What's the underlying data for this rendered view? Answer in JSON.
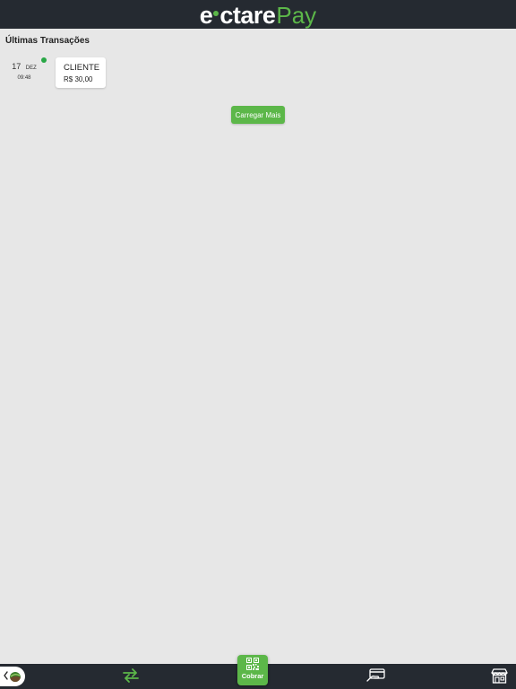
{
  "header": {
    "logo_e": "e",
    "logo_ctare": "ctare",
    "logo_pay": "Pay"
  },
  "transactions": {
    "title": "Últimas Transações",
    "items": [
      {
        "day": "17",
        "month": "DEZ",
        "time": "09:48",
        "name": "CLIENTE",
        "amount": "R$ 30,00",
        "status_color": "#28a745"
      }
    ],
    "load_more_label": "Carregar Mais"
  },
  "bottom_nav": {
    "back_icon": "chevron-left-icon",
    "avatar_icon": "leaf-avatar-icon",
    "transfer_icon": "arrows-transfer-icon",
    "cobrar_icon": "qr-code-icon",
    "cobrar_label": "Cobrar",
    "card_icon": "card-payment-icon",
    "store_icon": "store-icon"
  },
  "colors": {
    "header_bg": "#252a31",
    "accent_green": "#5cb749",
    "page_bg": "#e7e7e7"
  }
}
